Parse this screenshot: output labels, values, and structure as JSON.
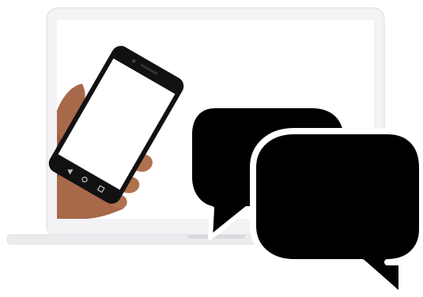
{
  "illustration": {
    "laptop_icon": "laptop-icon",
    "phone_icon": "smartphone-icon",
    "hand_icon": "hand-icon",
    "chat_icon": "speech-bubbles-icon"
  },
  "colors": {
    "background": "#ffffff",
    "laptop_frame": "#f3f3f5",
    "laptop_frame_edge": "#e6e6ea",
    "laptop_screen": "#ffffff",
    "laptop_base": "#ebebee",
    "laptop_notch": "#d9d9de",
    "phone_body": "#111111",
    "phone_screen": "#ffffff",
    "skin": "#a8684a",
    "skin_shadow": "#7c4630",
    "bubble": "#000000",
    "bubble_outline": "#ffffff"
  }
}
